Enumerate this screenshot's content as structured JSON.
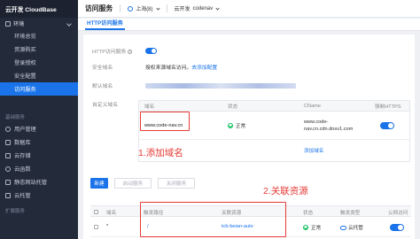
{
  "sidebar": {
    "brand": "云开发 CloudBase",
    "env_group": "环境",
    "env_items": [
      "环境总览",
      "资源购买",
      "登录授权",
      "安全配置",
      "访问服务"
    ],
    "active_item": "访问服务",
    "section_basic": "基础服务",
    "basic_items": [
      "用户管理",
      "数据库",
      "云存储",
      "云函数",
      "静态网站托管",
      "云托管"
    ],
    "section_extend": "扩展服务"
  },
  "topbar": {
    "title": "访问服务",
    "region": "上海(8)",
    "env_label": "云开发",
    "env_name": "codenav"
  },
  "tabs": [
    {
      "label": "HTTP访问服务"
    }
  ],
  "settings": {
    "http_label": "HTTP访问服务",
    "http_enabled": true,
    "domain_label": "安全域名",
    "domain_text": "授权来源域名访问。",
    "domain_link": "去添加配置",
    "default_domain_label": "默认域名",
    "custom_domain_label": "自定义域名"
  },
  "domain_table": {
    "headers": [
      "域名",
      "状态",
      "CName",
      "强制HTTPS"
    ],
    "row": {
      "domain": "www.code-nav.cn",
      "status": "正常",
      "cname": "www.code-nav.cn.cdn.dnsv1.com",
      "https_enabled": true
    },
    "add_link": "添加域名"
  },
  "annotations": {
    "step1": "1.添加域名",
    "step2": "2.关联资源"
  },
  "actions": {
    "new": "新建",
    "enable": "启动服务",
    "disable": "关闭服务"
  },
  "route_table": {
    "headers": [
      "域名",
      "触发路径",
      "关联资源",
      "状态",
      "触发类型",
      "公网访问"
    ],
    "row": {
      "domain": "*",
      "path": "/",
      "resource": "tcb-beian-auto",
      "status": "正常",
      "type": "云托管",
      "public_enabled": true
    }
  },
  "colors": {
    "accent": "#1a73e8",
    "sidebar_bg": "#232a3a",
    "annotation": "#e53935",
    "success": "#0abf5b"
  }
}
